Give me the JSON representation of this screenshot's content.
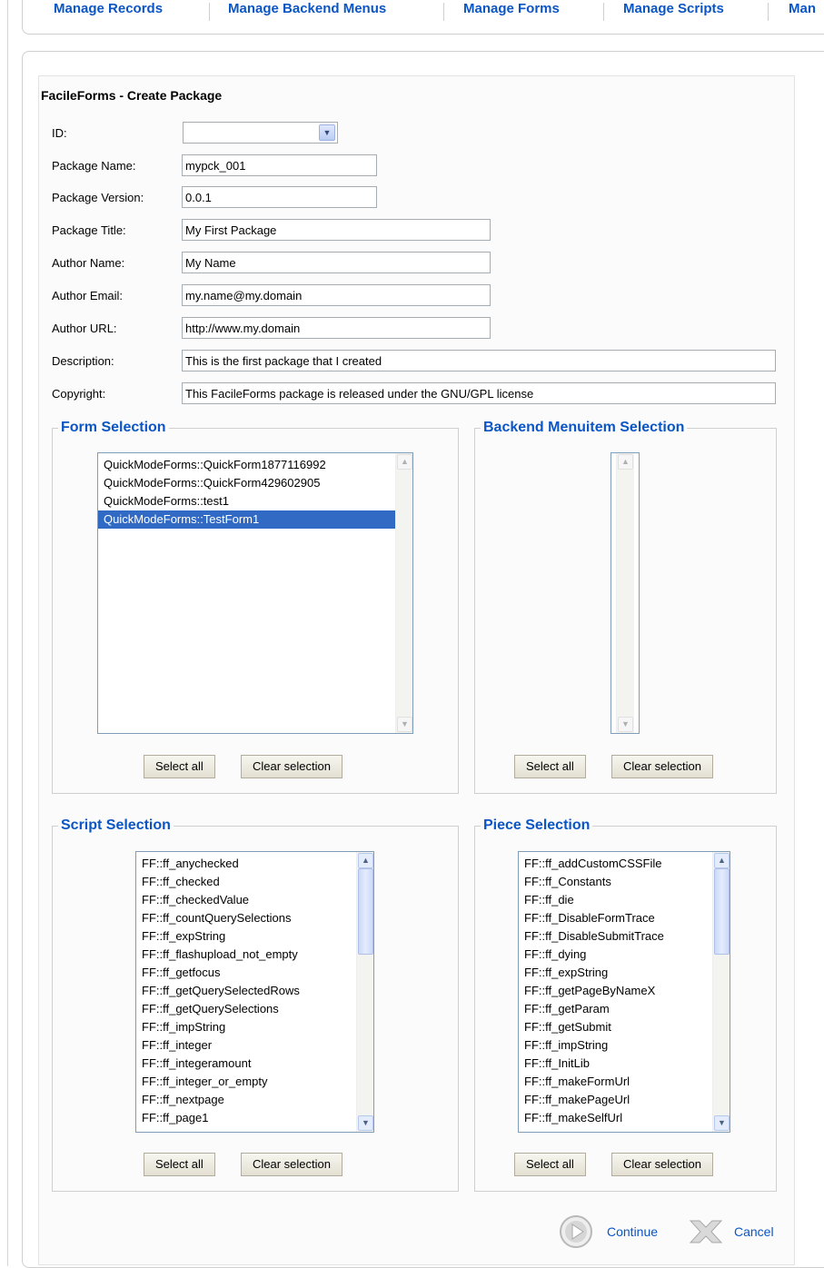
{
  "topnav": [
    "Manage Records",
    "Manage Backend Menus",
    "Manage Forms",
    "Manage Scripts",
    "Man"
  ],
  "title": "FacileForms - Create Package",
  "fields": {
    "id": {
      "label": "ID:",
      "value": ""
    },
    "package_name": {
      "label": "Package Name:",
      "value": "mypck_001"
    },
    "package_version": {
      "label": "Package Version:",
      "value": "0.0.1"
    },
    "package_title": {
      "label": "Package Title:",
      "value": "My First Package"
    },
    "author_name": {
      "label": "Author Name:",
      "value": "My Name"
    },
    "author_email": {
      "label": "Author Email:",
      "value": "my.name@my.domain"
    },
    "author_url": {
      "label": "Author URL:",
      "value": "http://www.my.domain"
    },
    "description": {
      "label": "Description:",
      "value": "This is the first package that I created"
    },
    "copyright": {
      "label": "Copyright:",
      "value": "This FacileForms package is released under the GNU/GPL license"
    }
  },
  "form_selection": {
    "legend": "Form Selection",
    "items": [
      "QuickModeForms::QuickForm1877116992",
      "QuickModeForms::QuickForm429602905",
      "QuickModeForms::test1",
      "QuickModeForms::TestForm1"
    ],
    "selected_index": 3
  },
  "menu_selection": {
    "legend": "Backend Menuitem Selection",
    "items": []
  },
  "script_selection": {
    "legend": "Script Selection",
    "items": [
      "FF::ff_anychecked",
      "FF::ff_checked",
      "FF::ff_checkedValue",
      "FF::ff_countQuerySelections",
      "FF::ff_expString",
      "FF::ff_flashupload_not_empty",
      "FF::ff_getfocus",
      "FF::ff_getQuerySelectedRows",
      "FF::ff_getQuerySelections",
      "FF::ff_impString",
      "FF::ff_integer",
      "FF::ff_integeramount",
      "FF::ff_integer_or_empty",
      "FF::ff_nextpage",
      "FF::ff_page1"
    ]
  },
  "piece_selection": {
    "legend": "Piece Selection",
    "items": [
      "FF::ff_addCustomCSSFile",
      "FF::ff_Constants",
      "FF::ff_die",
      "FF::ff_DisableFormTrace",
      "FF::ff_DisableSubmitTrace",
      "FF::ff_dying",
      "FF::ff_expString",
      "FF::ff_getPageByNameX",
      "FF::ff_getParam",
      "FF::ff_getSubmit",
      "FF::ff_impString",
      "FF::ff_InitLib",
      "FF::ff_makeFormUrl",
      "FF::ff_makePageUrl",
      "FF::ff_makeSelfUrl"
    ]
  },
  "buttons": {
    "select_all": "Select all",
    "clear_selection": "Clear selection"
  },
  "actions": {
    "continue": "Continue",
    "cancel": "Cancel"
  },
  "icons": {
    "dropdown": "chevron-down-icon",
    "scroll_up": "arrow-up-icon",
    "scroll_down": "arrow-down-icon",
    "continue": "play-circle-icon",
    "cancel": "cross-icon"
  },
  "colors": {
    "link": "#0b55c4",
    "selection": "#316ac5"
  }
}
